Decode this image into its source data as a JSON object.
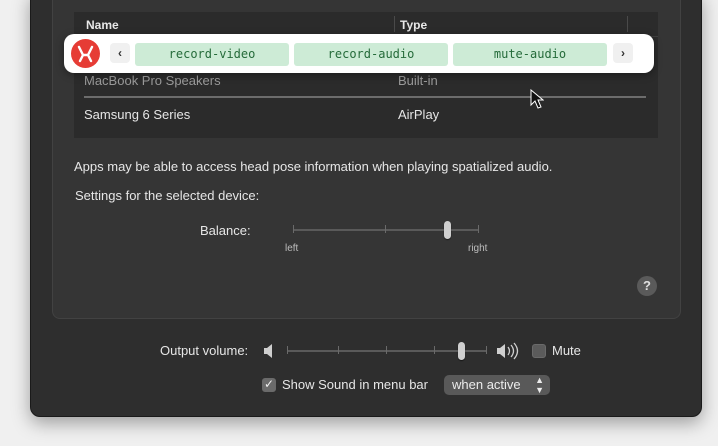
{
  "overlay": {
    "prev_label": "‹",
    "next_label": "›",
    "chips": [
      "record-video",
      "record-audio",
      "mute-audio"
    ]
  },
  "devices_table": {
    "headers": [
      "Name",
      "Type"
    ],
    "rows": [
      {
        "name": "MacBook Pro Speakers",
        "type": "Built-in"
      },
      {
        "name": "Samsung 6 Series",
        "type": "AirPlay"
      }
    ]
  },
  "head_pose_note": "Apps may be able to access head pose information when playing spatialized audio.",
  "settings_heading": "Settings for the selected device:",
  "balance": {
    "label": "Balance:",
    "left_label": "left",
    "right_label": "right",
    "value_fraction": 0.83
  },
  "help_label": "?",
  "output_volume": {
    "label": "Output volume:",
    "value_fraction": 0.87
  },
  "mute": {
    "label": "Mute",
    "checked": false
  },
  "menu_bar": {
    "label": "Show Sound in menu bar",
    "checked": true,
    "select_value": "when active"
  },
  "icons": {
    "logo": "red-app-logo-icon",
    "speaker_low": "speaker-low-icon",
    "speaker_high": "speaker-high-icon",
    "cursor": "mouse-pointer-icon"
  },
  "colors": {
    "window_bg": "#2e2e2e",
    "chip_bg": "#cdebd6",
    "chip_text": "#256b3a",
    "logo": "#e63c35"
  }
}
